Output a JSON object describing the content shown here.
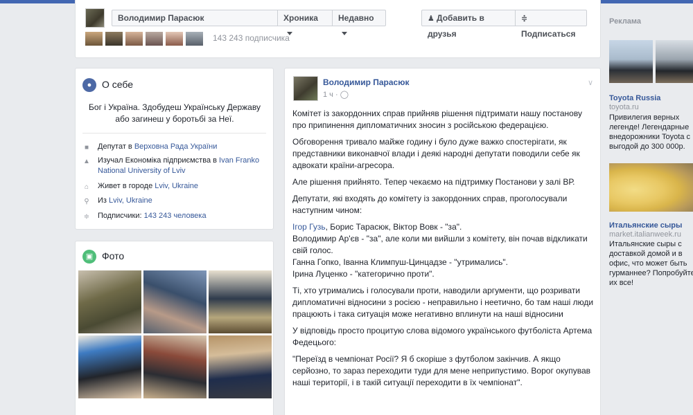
{
  "header": {
    "name": "Володимир Парасюк",
    "tab_chronicle": "Хроника",
    "tab_recent": "Недавно",
    "add_friend": "Добавить в друзья",
    "subscribe": "Подписаться",
    "followers": "143 243 подписчика"
  },
  "about": {
    "title": "О себе",
    "bio": "Бог і Україна. Здобудеш Українську Державу або загинеш у боротьбі за Неї.",
    "rows": [
      {
        "prefix": "Депутат в ",
        "link": "Верховна Рада України",
        "icon": "briefcase-icon"
      },
      {
        "prefix": "Изучал Економіка підприємства в ",
        "link": "Ivan Franko National University of Lviv",
        "icon": "graduation-cap-icon"
      },
      {
        "prefix": "Живет в городе ",
        "link": "Lviv, Ukraine",
        "icon": "home-icon"
      },
      {
        "prefix": "Из ",
        "link": "Lviv, Ukraine",
        "icon": "location-pin-icon"
      },
      {
        "prefix": "Подписчики: ",
        "link": "143 243 человека",
        "icon": "rss-icon"
      }
    ]
  },
  "photos": {
    "title": "Фото"
  },
  "post": {
    "author": "Володимир Парасюк",
    "time": "1 ч · ",
    "paragraphs": [
      "Комітет із закордонних справ прийняв рішення підтримати нашу постанову про припинення дипломатичних зносин з російською федерацією.",
      "Обговорення тривало майже годину і було дуже важко спостерігати, як представники виконавчої влади і деякі народні депутати поводили себе як адвокати країни-агресора.",
      "Але рішення прийнято. Тепер чекаємо на підтримку Постанови у залі ВР.",
      "Депутати, які входять до комітету із закордонних справ, проголосували наступним чином:"
    ],
    "vote_link": "Ігор Гузь",
    "vote_line1_rest": ", Борис Тарасюк, Віктор Вовк - \"за\".",
    "vote_line2": "Володимир Ар'єв - \"за\", але коли ми вийшли з комітету, він почав відкликати свій голос.",
    "vote_line3": "Ганна Гопко, Іванна Климпуш-Цинцадзе - \"утримались\".",
    "vote_line4": "Ірина Луценко - \"категорично проти\".",
    "paragraphs2": [
      "Ті, хто утримались і голосували проти, наводили аргументи, що розривати дипломатичні відносини з росією - неправильно і неетично, бо там наші люди працюють і така ситуація може негативно вплинути на наші відносини",
      "У відповідь просто процитую слова відомого українського футболіста Артема Федецього:",
      "\"Переїзд в чемпіонат Росії? Я б скоріше з футболом закінчив. А якщо серйозно, то зараз переходити туди для мене неприпустимо. Ворог окупував наші території, і в такій ситуації переходити в їх чемпіонат\"."
    ]
  },
  "ads": {
    "header": "Реклама",
    "items": [
      {
        "title": "Toyota Russia",
        "url": "toyota.ru",
        "text": "Привилегия верных легенде! Легендарные внедорожники Toyota с выгодой до 300 000р."
      },
      {
        "title": "Итальянские сыры",
        "url": "market.italianweek.ru",
        "text": "Итальянские сыры с доставкой домой и в офис, что может быть гурманнее? Попробуйте их все!"
      }
    ]
  }
}
